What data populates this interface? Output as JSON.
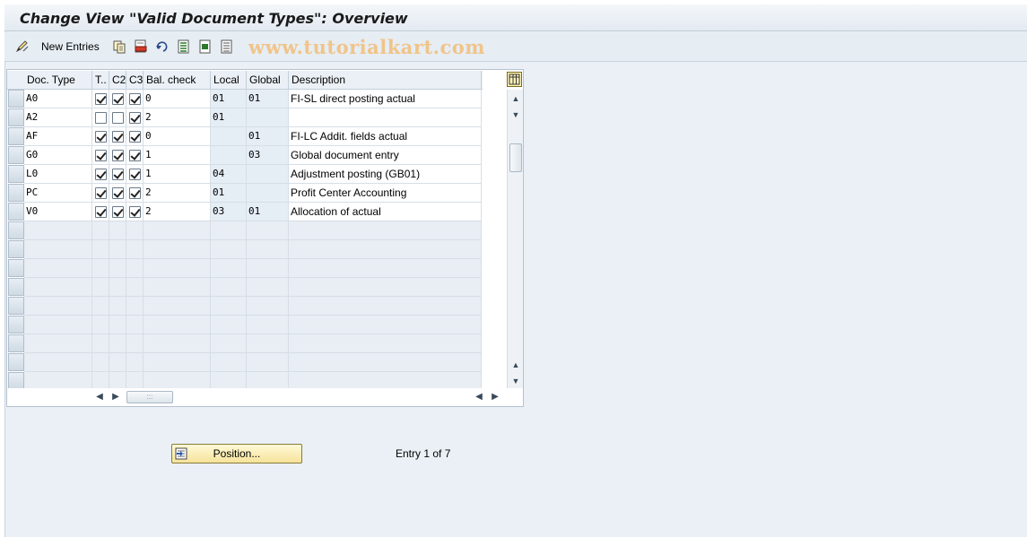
{
  "window": {
    "title": "Change View \"Valid Document Types\": Overview"
  },
  "toolbar": {
    "new_entries_label": "New Entries",
    "watermark": "www.tutorialkart.com",
    "icons": [
      "display-change-icon",
      "copy-icon",
      "delete-icon",
      "undo-icon",
      "select-all-icon",
      "select-block-icon",
      "deselect-all-icon"
    ]
  },
  "table": {
    "columns": [
      "Doc. Type",
      "T..",
      "C2",
      "C3",
      "Bal. check",
      "Local",
      "Global",
      "Description"
    ],
    "rows": [
      {
        "doc_type": "A0",
        "t": true,
        "c2": true,
        "c3": true,
        "bal": "0",
        "local": "01",
        "global": "01",
        "desc": "FI-SL direct posting actual"
      },
      {
        "doc_type": "A2",
        "t": false,
        "c2": false,
        "c3": true,
        "bal": "2",
        "local": "01",
        "global": "",
        "desc": ""
      },
      {
        "doc_type": "AF",
        "t": true,
        "c2": true,
        "c3": true,
        "bal": "0",
        "local": "",
        "global": "01",
        "desc": "FI-LC Addit. fields actual"
      },
      {
        "doc_type": "G0",
        "t": true,
        "c2": true,
        "c3": true,
        "bal": "1",
        "local": "",
        "global": "03",
        "desc": "Global document entry"
      },
      {
        "doc_type": "L0",
        "t": true,
        "c2": true,
        "c3": true,
        "bal": "1",
        "local": "04",
        "global": "",
        "desc": "Adjustment posting (GB01)"
      },
      {
        "doc_type": "PC",
        "t": true,
        "c2": true,
        "c3": true,
        "bal": "2",
        "local": "01",
        "global": "",
        "desc": "Profit Center Accounting"
      },
      {
        "doc_type": "V0",
        "t": true,
        "c2": true,
        "c3": true,
        "bal": "2",
        "local": "03",
        "global": "01",
        "desc": "Allocation of actual"
      }
    ],
    "empty_rows": 9
  },
  "footer": {
    "position_button": "Position...",
    "entry_text": "Entry 1 of 7"
  },
  "colors": {
    "frame_bg": "#eaf0f5",
    "button_yellow": "#f6e39a",
    "watermark": "#f0c48a"
  }
}
